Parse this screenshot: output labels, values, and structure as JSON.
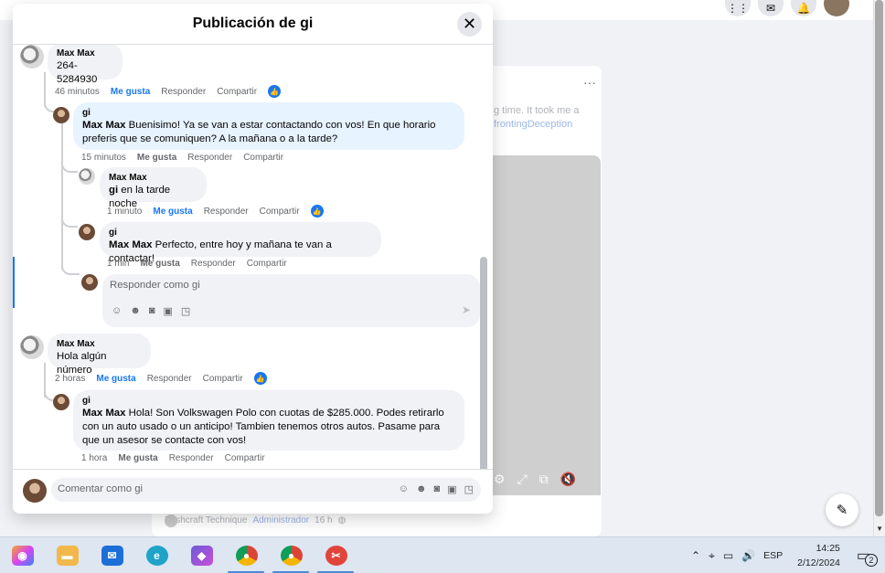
{
  "background": {
    "post_text": "g time. It took me a",
    "post_tag": "frontingDeception",
    "author_name": "Bushcraft Technique",
    "author_role": "Administrador",
    "author_time": "16 h"
  },
  "modal": {
    "title": "Publicación de gi",
    "reply_placeholder": "Responder como gi",
    "comment_placeholder": "Comentar como gi"
  },
  "comments": [
    {
      "author": "Max Max",
      "text": "264-5284930",
      "time": "46 minutos",
      "like": "Me gusta",
      "reply": "Responder",
      "share": "Compartir"
    },
    {
      "author": "gi",
      "tag": "Max Max",
      "text": " Buenisimo! Ya se van a estar contactando con vos! En que horario preferis que se comuniquen? A la mañana o a la tarde?",
      "time": "15 minutos",
      "like": "Me gusta",
      "reply": "Responder",
      "share": "Compartir"
    },
    {
      "author": "Max Max",
      "tag": "gi",
      "text": " en la tarde noche",
      "time": "1 minuto",
      "like": "Me gusta",
      "reply": "Responder",
      "share": "Compartir"
    },
    {
      "author": "gi",
      "tag": "Max Max",
      "text": " Perfecto, entre hoy y mañana te van a contactar!",
      "time": "1 min",
      "like": "Me gusta",
      "reply": "Responder",
      "share": "Compartir"
    },
    {
      "author": "Max Max",
      "text": "Hola algún número",
      "time": "2 horas",
      "like": "Me gusta",
      "reply": "Responder",
      "share": "Compartir"
    },
    {
      "author": "gi",
      "tag": "Max Max",
      "text": " Hola! Son Volkswagen Polo con cuotas de $285.000. Podes retirarlo con un auto usado o un anticipo! Tambien tenemos otros autos. Pasame para que un asesor se contacte con vos!",
      "time": "1 hora",
      "like": "Me gusta",
      "reply": "Responder",
      "share": "Compartir"
    }
  ],
  "taskbar": {
    "language": "ESP",
    "time": "14:25",
    "date": "2/12/2024",
    "notifications": "2",
    "apps": [
      "copilot-icon",
      "file-explorer-icon",
      "mail-icon",
      "edge-icon",
      "m365-icon",
      "chrome-profile-icon",
      "chrome-icon",
      "snipping-tool-icon"
    ]
  },
  "colors": {
    "accent": "#1877f2",
    "bubble": "#f0f2f5",
    "bubble_highlight": "#e7f3ff"
  }
}
